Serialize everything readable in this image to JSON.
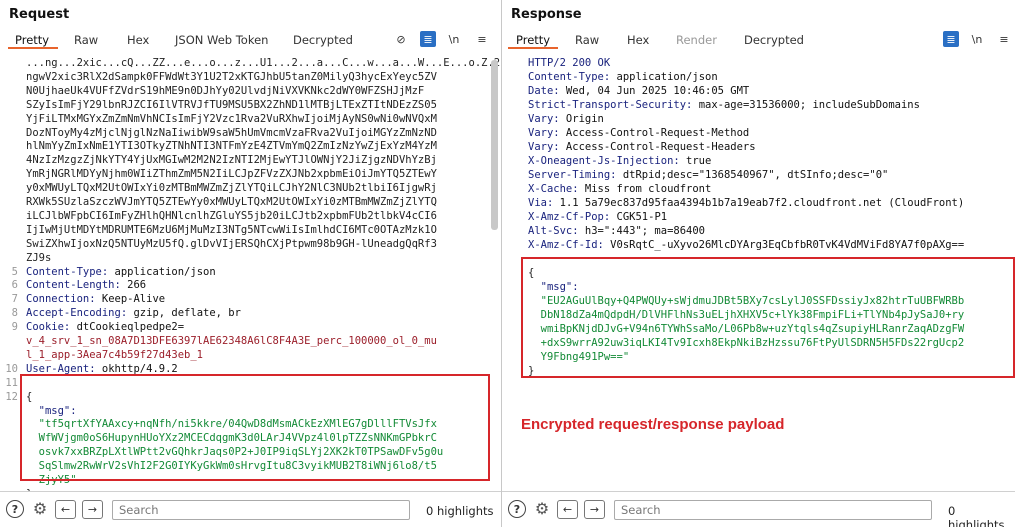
{
  "request": {
    "title": "Request",
    "tabs": [
      "Pretty",
      "Raw",
      "Hex",
      "JSON Web Token",
      "Decrypted"
    ],
    "tools": {
      "newline": "\\n",
      "menu": "≡"
    },
    "lines": [
      {
        "n": "",
        "t": "...ng...2xic...cQ...ZZ...e...o...z...U1...2...a...C...w...a...W...E...o.Z.2.",
        "k": "token"
      },
      {
        "n": "",
        "t": "ngwV2xic3RlX2dSampk0FFWdWt3Y1U2T2xKTGJhbU5tanZ0MilyQ3hycExYeyc5ZV",
        "k": "token"
      },
      {
        "n": "",
        "t": "N0UjhaeUk4VUFfZVdrS19hME9n0DJhYy02UlvdjNiVXVKNkc2dWY0WFZSHJjMzF",
        "k": "token"
      },
      {
        "n": "",
        "t": "SZyIsImFjY29lbnRJZCI6IlVTRVJfTU9MSU5BX2ZhND1lMTBjLTExZTItNDEzZS05",
        "k": "token"
      },
      {
        "n": "",
        "t": "YjFiLTMxMGYxZmZmNmVhNCIsImFjY2Vzc1Rva2VuRXhwIjoiMjAyNS0wNi0wNVQxM",
        "k": "token"
      },
      {
        "n": "",
        "t": "DozNToyMy4zMjclNjglNzNaIiwibW9saW5hUmVmcmVzaFRva2VuIjoiMGYzZmNzND",
        "k": "token"
      },
      {
        "n": "",
        "t": "hlNmYyZmIxNmE1YTI3OTkyZTNhNTI3NTFmYzE4ZTVmYmQ2ZmIzNzYwZjExYzM4YzM",
        "k": "token"
      },
      {
        "n": "",
        "t": "4NzIzMzgzZjNkYTY4YjUxMGIwM2M2N2IzNTI2MjEwYTJlOWNjY2JiZjgzNDVhYzBj",
        "k": "token"
      },
      {
        "n": "",
        "t": "YmRjNGRlMDYyNjhm0WIiZThmZmM5N2IiLCJpZFVzZXJNb2xpbmEiOiJmYTQ5ZTEwY",
        "k": "token"
      },
      {
        "n": "",
        "t": "y0xMWUyLTQxM2UtOWIxYi0zMTBmMWZmZjZlYTQiLCJhY2NlC3NUb2tlbiI6IjgwRj",
        "k": "token"
      },
      {
        "n": "",
        "t": "RXWk5SUzlaSzczWVJmYTQ5ZTEwYy0xMWUyLTQxM2UtOWIxYi0zMTBmMWZmZjZlYTQ",
        "k": "token"
      },
      {
        "n": "",
        "t": "iLCJlbWFpbCI6ImFyZHlhQHNlcnlhZGluYS5jb20iLCJtb2xpbmFUb2tlbkV4cCI6",
        "k": "token"
      },
      {
        "n": "",
        "t": "IjIwMjUtMDYtMDRUMTE6MzU6MjMuMzI3NTg5NTcwWiIsImlhdCI6MTc0OTAzMzk1O",
        "k": "token"
      },
      {
        "n": "",
        "t": "SwiZXhwIjoxNzQ5NTUyMzU5fQ.glDvVIjERSQhCXjPtpwm98b9GH-lUneadgQqRf3",
        "k": "token"
      },
      {
        "n": "",
        "t": "ZJ9s",
        "k": "token"
      },
      {
        "n": "5",
        "hk": "Content-Type:",
        "hv": " application/json",
        "k": "header"
      },
      {
        "n": "6",
        "hk": "Content-Length:",
        "hv": " 266",
        "k": "header"
      },
      {
        "n": "7",
        "hk": "Connection:",
        "hv": " Keep-Alive",
        "k": "header"
      },
      {
        "n": "8",
        "hk": "Accept-Encoding:",
        "hv": " gzip, deflate, br",
        "k": "header"
      },
      {
        "n": "9",
        "hk": "Cookie:",
        "hv": " dtCookieqlpedpe2=",
        "k": "header"
      },
      {
        "n": "",
        "t": "v_4_srv_1_sn_08A7D13DFE6397lAE62348A6lC8F4A3E_perc_100000_ol_0_mu",
        "k": "cookie"
      },
      {
        "n": "",
        "t": "l_1_app-3Aea7c4b59f27d43eb_1",
        "k": "cookie"
      },
      {
        "n": "10",
        "hk": "User-Agent:",
        "hv": " okhttp/4.9.2",
        "k": "header"
      },
      {
        "n": "11",
        "t": "",
        "k": "plain"
      },
      {
        "n": "12",
        "t": "{",
        "k": "plain"
      },
      {
        "n": "",
        "t": "  \"msg\":",
        "k": "jsonkey"
      },
      {
        "n": "",
        "t": "  \"tf5qrtXfYAAxcy+nqNfh/ni5kkre/04QwD8dMsmACkEzXMlEG7gDlllFTVsJfx",
        "k": "jsonval"
      },
      {
        "n": "",
        "t": "  WfWVjgm0oS6HupynHUoYXz2MCECdqgmK3d0LArJ4VVpz4l0lpTZZsNNKmGPbkrC",
        "k": "jsonval"
      },
      {
        "n": "",
        "t": "  osvk7xxBRZpLXtlWPtt2vGQhkrJaqs0P2+J0IP9iqSLYj2XK2kT0TPSawDFv5g0u",
        "k": "jsonval"
      },
      {
        "n": "",
        "t": "  SqSlmw2RwWrV2sVhI2F2G0IYKyGkWm0sHrvgItu8C3vyikMUB2T8iWNj6lo8/t5",
        "k": "jsonval"
      },
      {
        "n": "",
        "t": "  ZjyY5\"",
        "k": "jsonval"
      },
      {
        "n": "",
        "t": "}",
        "k": "plain"
      }
    ],
    "search_placeholder": "Search",
    "highlights": "0 highlights"
  },
  "response": {
    "title": "Response",
    "tabs": [
      "Pretty",
      "Raw",
      "Hex",
      "Render",
      "Decrypted"
    ],
    "tools": {
      "newline": "\\n",
      "menu": "≡"
    },
    "lines": [
      {
        "hk": "HTTP/2 200 OK",
        "hv": "",
        "k": "status"
      },
      {
        "hk": "Content-Type:",
        "hv": " application/json",
        "k": "header"
      },
      {
        "hk": "Date:",
        "hv": " Wed, 04 Jun 2025 10:46:05 GMT",
        "k": "header"
      },
      {
        "hk": "Strict-Transport-Security:",
        "hv": " max-age=31536000; includeSubDomains",
        "k": "header"
      },
      {
        "hk": "Vary:",
        "hv": " Origin",
        "k": "header"
      },
      {
        "hk": "Vary:",
        "hv": " Access-Control-Request-Method",
        "k": "header"
      },
      {
        "hk": "Vary:",
        "hv": " Access-Control-Request-Headers",
        "k": "header"
      },
      {
        "hk": "X-Oneagent-Js-Injection:",
        "hv": " true",
        "k": "header"
      },
      {
        "hk": "Server-Timing:",
        "hv": " dtRpid;desc=\"1368540967\", dtSInfo;desc=\"0\"",
        "k": "header"
      },
      {
        "hk": "X-Cache:",
        "hv": " Miss from cloudfront",
        "k": "header"
      },
      {
        "hk": "Via:",
        "hv": " 1.1 5a79ec837d95faa4394b1b7a19eab7f2.cloudfront.net (CloudFront)",
        "k": "header"
      },
      {
        "hk": "X-Amz-Cf-Pop:",
        "hv": " CGK51-P1",
        "k": "header"
      },
      {
        "hk": "Alt-Svc:",
        "hv": " h3=\":443\"; ma=86400",
        "k": "header"
      },
      {
        "hk": "X-Amz-Cf-Id:",
        "hv": " V0sRqtC_-uXyvo26MlcDYArg3EqCbfbR0TvK4VdMViFd8YA7f0pAXg==",
        "k": "header"
      },
      {
        "hk": "",
        "hv": "",
        "k": "plain"
      },
      {
        "t": "{",
        "k": "plain"
      },
      {
        "t": "  \"msg\":",
        "k": "jsonkey"
      },
      {
        "t": "  \"EU2AGuUlBqy+Q4PWQUy+sWjdmuJDBt5BXy7csLylJ0SSFDssiyJx82htrTuUBFWRBb",
        "k": "jsonval"
      },
      {
        "t": "  DbN18dZa4mQdpdH/DlVHFlhNs3uELjhXHXV5c+lYk38FmpiFLi+TlYNb4pJySaJ0+ry",
        "k": "jsonval"
      },
      {
        "t": "  wmiBpKNjdDJvG+V94n6TYWhSsaMo/L06Pb8w+uzYtqls4qZsupiyHLRanrZaqADzgFW",
        "k": "jsonval"
      },
      {
        "t": "  +dxS9wrrA92uw3iqLKI4Tv9Icxh8EkpNkiBzHzssu76FtPyUlSDRN5H5FDs22rgUcp2",
        "k": "jsonval"
      },
      {
        "t": "  Y9Fbng491Pw==\"",
        "k": "jsonval"
      },
      {
        "t": "}",
        "k": "plain"
      }
    ],
    "search_placeholder": "Search",
    "highlights": "0 highlights"
  },
  "annotation": "Encrypted request/response payload",
  "icons": {
    "help": "?",
    "settings": "⚙",
    "back": "←",
    "forward": "→",
    "eye_off": "⊘",
    "wrap": "≣"
  },
  "colors": {
    "accent_tab": "#e8642c",
    "tool_blue": "#2a6fc4",
    "highlight_red": "#d6262a",
    "json_value": "#138a36",
    "header_key": "#1a237e",
    "cookie_value": "#9b1e2a"
  }
}
